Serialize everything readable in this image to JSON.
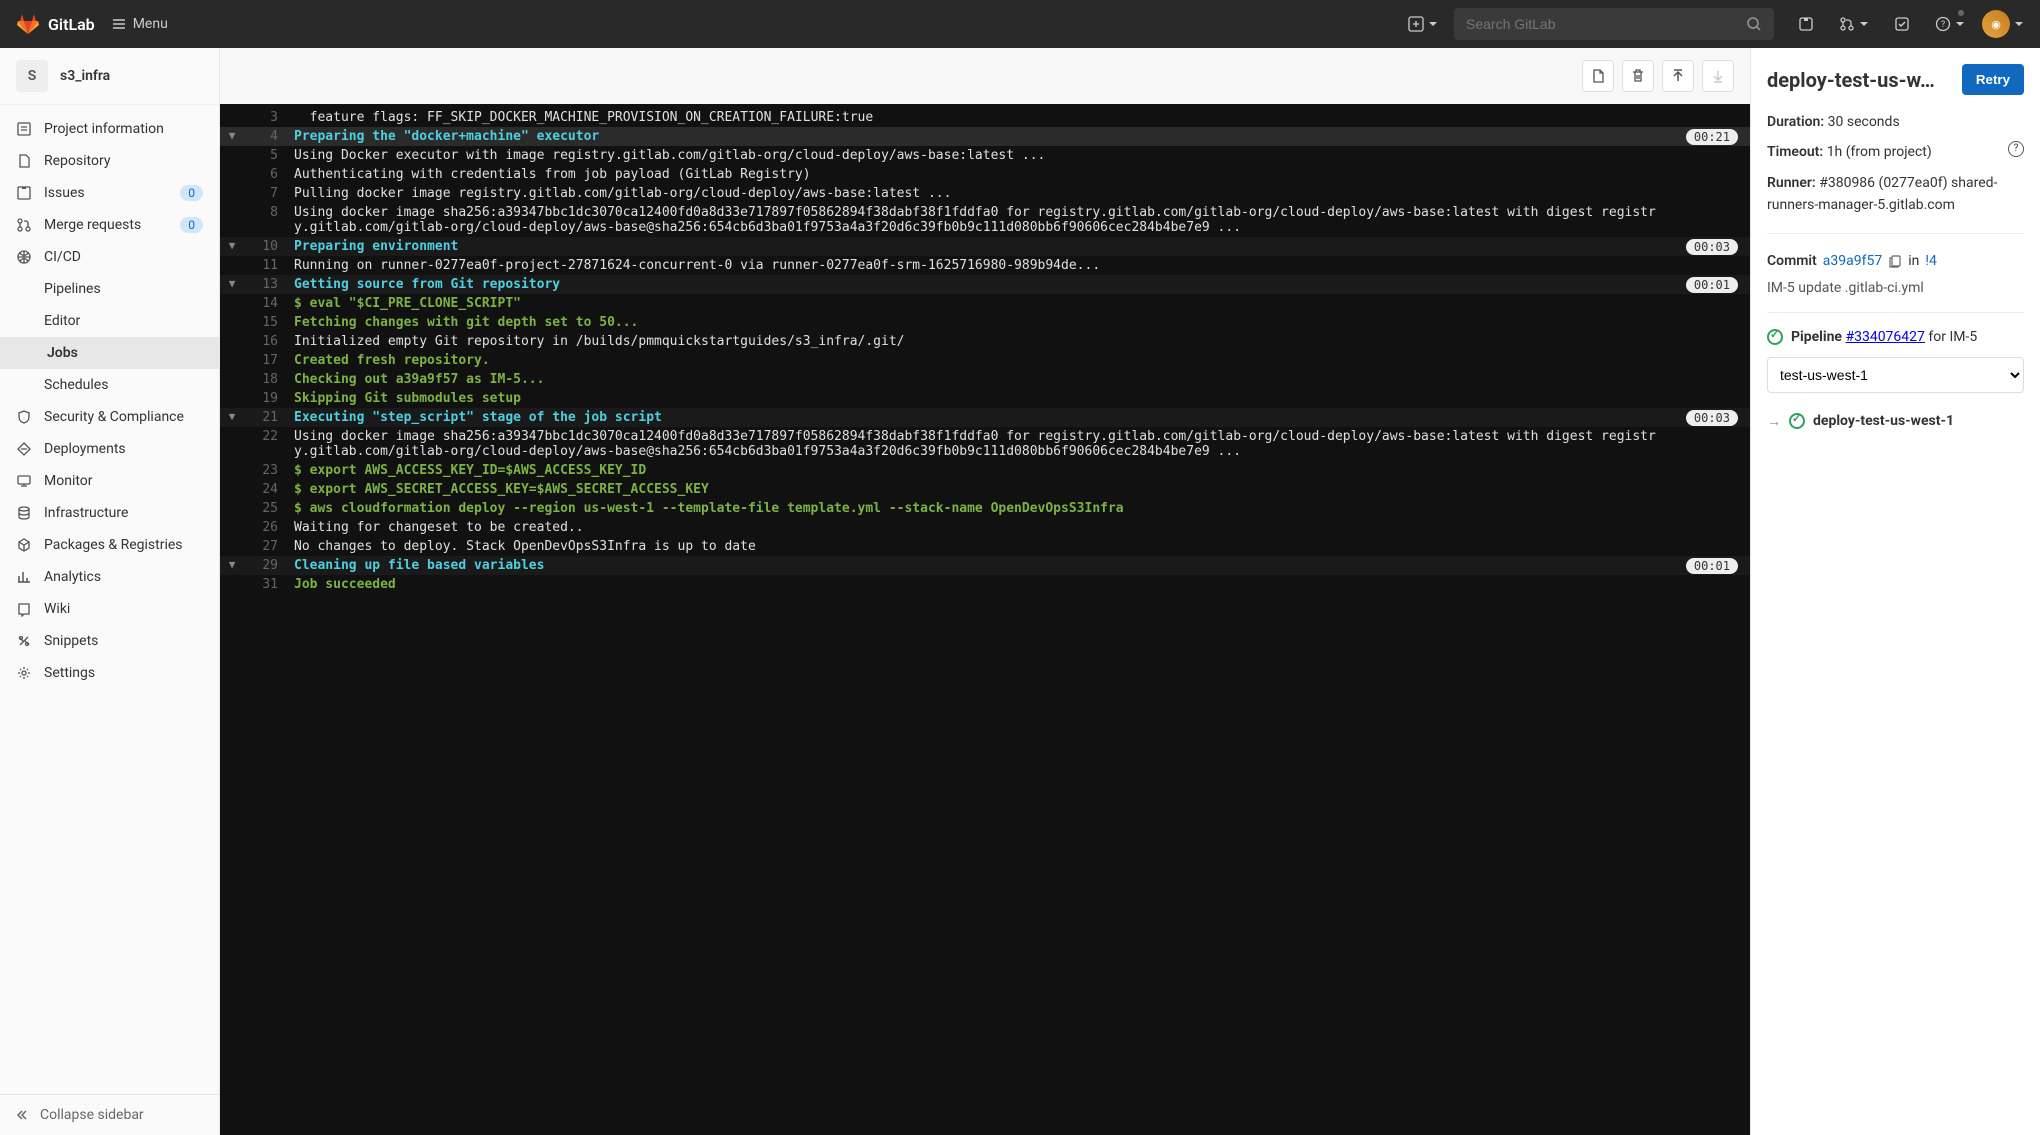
{
  "header": {
    "brand": "GitLab",
    "menu_label": "Menu",
    "search_placeholder": "Search GitLab"
  },
  "project": {
    "avatar_letter": "S",
    "name": "s3_infra"
  },
  "sidebar": {
    "items": [
      {
        "label": "Project information"
      },
      {
        "label": "Repository"
      },
      {
        "label": "Issues",
        "badge": "0"
      },
      {
        "label": "Merge requests",
        "badge": "0"
      },
      {
        "label": "CI/CD"
      },
      {
        "label": "Security & Compliance"
      },
      {
        "label": "Deployments"
      },
      {
        "label": "Monitor"
      },
      {
        "label": "Infrastructure"
      },
      {
        "label": "Packages & Registries"
      },
      {
        "label": "Analytics"
      },
      {
        "label": "Wiki"
      },
      {
        "label": "Snippets"
      },
      {
        "label": "Settings"
      }
    ],
    "cicd_sub": [
      {
        "label": "Pipelines"
      },
      {
        "label": "Editor"
      },
      {
        "label": "Jobs",
        "active": true
      },
      {
        "label": "Schedules"
      }
    ],
    "collapse_label": "Collapse sidebar"
  },
  "log": [
    {
      "n": 3,
      "cls": "plain",
      "text": "  feature flags: FF_SKIP_DOCKER_MACHINE_PROVISION_ON_CREATION_FAILURE:true"
    },
    {
      "n": 4,
      "cls": "cyan",
      "text": "Preparing the \"docker+machine\" executor",
      "section": true,
      "hl": true,
      "timing": "00:21"
    },
    {
      "n": 5,
      "cls": "plain",
      "text": "Using Docker executor with image registry.gitlab.com/gitlab-org/cloud-deploy/aws-base:latest ..."
    },
    {
      "n": 6,
      "cls": "plain",
      "text": "Authenticating with credentials from job payload (GitLab Registry)"
    },
    {
      "n": 7,
      "cls": "plain",
      "text": "Pulling docker image registry.gitlab.com/gitlab-org/cloud-deploy/aws-base:latest ..."
    },
    {
      "n": 8,
      "cls": "plain",
      "text": "Using docker image sha256:a39347bbc1dc3070ca12400fd0a8d33e717897f05862894f38dabf38f1fddfa0 for registry.gitlab.com/gitlab-org/cloud-deploy/aws-base:latest with digest registry.gitlab.com/gitlab-org/cloud-deploy/aws-base@sha256:654cb6d3ba01f9753a4a3f20d6c39fb0b9c111d080bb6f90606cec284b4be7e9 ..."
    },
    {
      "n": 10,
      "cls": "cyan",
      "text": "Preparing environment",
      "section": true,
      "timing": "00:03"
    },
    {
      "n": 11,
      "cls": "plain",
      "text": "Running on runner-0277ea0f-project-27871624-concurrent-0 via runner-0277ea0f-srm-1625716980-989b94de..."
    },
    {
      "n": 13,
      "cls": "cyan",
      "text": "Getting source from Git repository",
      "section": true,
      "timing": "00:01"
    },
    {
      "n": 14,
      "cls": "green",
      "text": "$ eval \"$CI_PRE_CLONE_SCRIPT\""
    },
    {
      "n": 15,
      "cls": "green",
      "text": "Fetching changes with git depth set to 50..."
    },
    {
      "n": 16,
      "cls": "plain",
      "text": "Initialized empty Git repository in /builds/pmmquickstartguides/s3_infra/.git/"
    },
    {
      "n": 17,
      "cls": "green",
      "text": "Created fresh repository."
    },
    {
      "n": 18,
      "cls": "green",
      "text": "Checking out a39a9f57 as IM-5..."
    },
    {
      "n": 19,
      "cls": "green",
      "text": "Skipping Git submodules setup"
    },
    {
      "n": 21,
      "cls": "cyan",
      "text": "Executing \"step_script\" stage of the job script",
      "section": true,
      "timing": "00:03"
    },
    {
      "n": 22,
      "cls": "plain",
      "text": "Using docker image sha256:a39347bbc1dc3070ca12400fd0a8d33e717897f05862894f38dabf38f1fddfa0 for registry.gitlab.com/gitlab-org/cloud-deploy/aws-base:latest with digest registry.gitlab.com/gitlab-org/cloud-deploy/aws-base@sha256:654cb6d3ba01f9753a4a3f20d6c39fb0b9c111d080bb6f90606cec284b4be7e9 ..."
    },
    {
      "n": 23,
      "cls": "green",
      "text": "$ export AWS_ACCESS_KEY_ID=$AWS_ACCESS_KEY_ID"
    },
    {
      "n": 24,
      "cls": "green",
      "text": "$ export AWS_SECRET_ACCESS_KEY=$AWS_SECRET_ACCESS_KEY"
    },
    {
      "n": 25,
      "cls": "green",
      "text": "$ aws cloudformation deploy --region us-west-1 --template-file template.yml --stack-name OpenDevOpsS3Infra"
    },
    {
      "n": 26,
      "cls": "plain",
      "text": "Waiting for changeset to be created.."
    },
    {
      "n": 27,
      "cls": "plain",
      "text": "No changes to deploy. Stack OpenDevOpsS3Infra is up to date"
    },
    {
      "n": 29,
      "cls": "cyan",
      "text": "Cleaning up file based variables",
      "section": true,
      "timing": "00:01"
    },
    {
      "n": 31,
      "cls": "green",
      "text": "Job succeeded"
    }
  ],
  "detail": {
    "job_title": "deploy-test-us-w…",
    "retry_label": "Retry",
    "duration_label": "Duration:",
    "duration_value": "30 seconds",
    "timeout_label": "Timeout:",
    "timeout_value": "1h (from project)",
    "runner_label": "Runner:",
    "runner_value": "#380986 (0277ea0f) shared-runners-manager-5.gitlab.com",
    "commit_label": "Commit",
    "commit_sha": "a39a9f57",
    "commit_in": "in",
    "commit_mr": "!4",
    "commit_msg": "IM-5 update .gitlab-ci.yml",
    "pipeline_label": "Pipeline",
    "pipeline_id": "#334076427",
    "pipeline_for": "for IM-5",
    "stage_selected": "test-us-west-1",
    "job_link_label": "deploy-test-us-west-1"
  }
}
